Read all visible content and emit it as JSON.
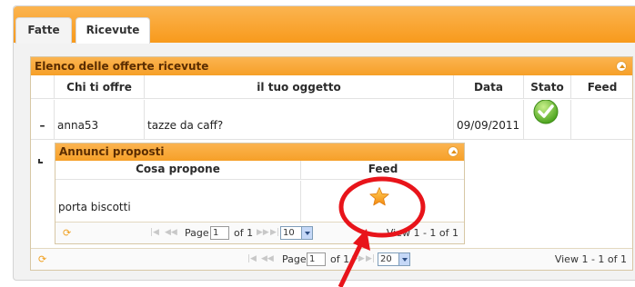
{
  "tabs": {
    "fatte": "Fatte",
    "ricevute": "Ricevute"
  },
  "outer_grid": {
    "caption": "Elenco delle offerte ricevute",
    "headers": {
      "chi": "Chi ti offre",
      "oggetto": "il tuo oggetto",
      "data": "Data",
      "stato": "Stato",
      "feed": "Feed"
    },
    "row": {
      "expand": "–",
      "chi": "anna53",
      "oggetto": "tazze da caff?",
      "data": "09/09/2011 ("
    },
    "pager": {
      "page_label": "Page",
      "page_value": "1",
      "of_label": "of 1",
      "rows_value": "20",
      "view": "View 1 - 1 of 1"
    }
  },
  "sub_grid": {
    "caption": "Annunci proposti",
    "headers": {
      "propone": "Cosa propone",
      "feed": "Feed"
    },
    "row": {
      "propone": "porta biscotti"
    },
    "pager": {
      "page_label": "Page",
      "page_value": "1",
      "of_label": "of 1",
      "rows_value": "10",
      "view": "View 1 - 1 of 1"
    }
  },
  "colors": {
    "accent": "#f89a1c",
    "annotation": "#e8141a",
    "star": "#f7a21a",
    "check": "#5fb82c"
  },
  "icons": {
    "stato": "check-icon",
    "feed": "star-icon",
    "refresh": "refresh-icon"
  }
}
